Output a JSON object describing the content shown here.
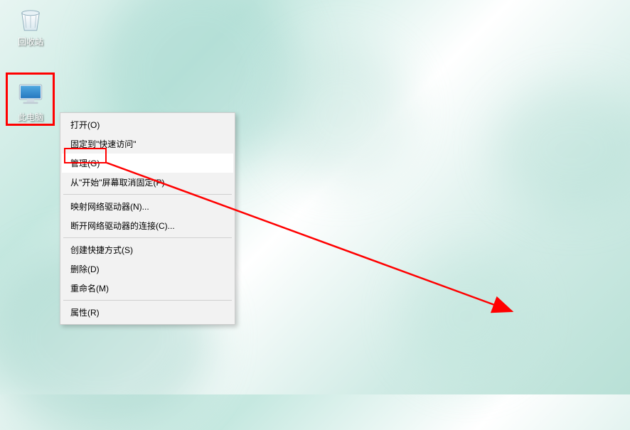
{
  "desktop": {
    "icons": {
      "recycle_bin": {
        "label": "回收站"
      },
      "this_pc": {
        "label": "此电脑"
      }
    }
  },
  "context_menu": {
    "items": [
      {
        "label": "打开(O)"
      },
      {
        "label": "固定到\"快速访问\""
      },
      {
        "label": "管理(G)",
        "highlighted": true
      },
      {
        "label": "从\"开始\"屏幕取消固定(P)"
      }
    ],
    "group2": [
      {
        "label": "映射网络驱动器(N)..."
      },
      {
        "label": "断开网络驱动器的连接(C)..."
      }
    ],
    "group3": [
      {
        "label": "创建快捷方式(S)"
      },
      {
        "label": "删除(D)"
      },
      {
        "label": "重命名(M)"
      }
    ],
    "group4": [
      {
        "label": "属性(R)"
      }
    ]
  },
  "annotation": {
    "highlight_color": "#ff0000",
    "arrow_from": "manage-menu-item",
    "arrow_to": "bottom-right-area"
  }
}
